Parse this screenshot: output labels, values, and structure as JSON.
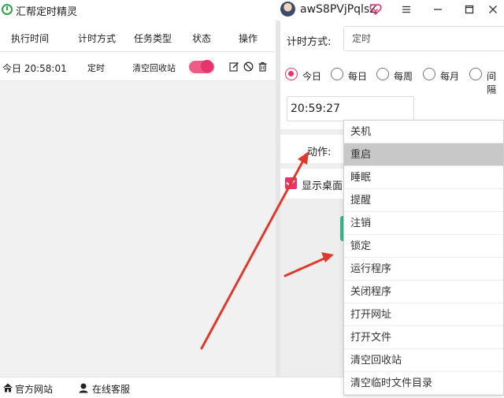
{
  "window": {
    "title": "汇帮定时精灵",
    "username": "awS8PVjPqlsZ",
    "icons": [
      "clock-icon",
      "vip-heart-icon",
      "menu-icon",
      "minimize-icon",
      "maximize-icon",
      "close-icon"
    ]
  },
  "task_table": {
    "columns": [
      "执行时间",
      "计时方式",
      "任务类型",
      "状态",
      "操作"
    ],
    "rows": [
      {
        "exec_time": "今日 20:58:01",
        "mode": "定时",
        "task_type": "清空回收站",
        "status_on": true
      }
    ]
  },
  "settings": {
    "timing_label": "计时方式:",
    "timing_value": "定时",
    "frequency_options": [
      "今日",
      "每日",
      "每周",
      "每月",
      "间隔"
    ],
    "frequency_selected": "今日",
    "time_value": "20:59:27",
    "action_label": "动作:",
    "show_desktop_label": "显示桌面",
    "show_desktop_checked": true
  },
  "action_dropdown": {
    "items": [
      "关机",
      "重启",
      "睡眠",
      "提醒",
      "注销",
      "锁定",
      "运行程序",
      "关闭程序",
      "打开网址",
      "打开文件",
      "清空回收站",
      "清空临时文件目录"
    ],
    "highlighted": "重启"
  },
  "footer": {
    "website_label": "官方网站",
    "support_label": "在线客服"
  },
  "colors": {
    "accent": "#e8346c",
    "toggle_track": "#ef5a86",
    "app_green": "#2aa44a",
    "annotation_red": "#e0392b",
    "tab_teal": "#3bb58e"
  }
}
